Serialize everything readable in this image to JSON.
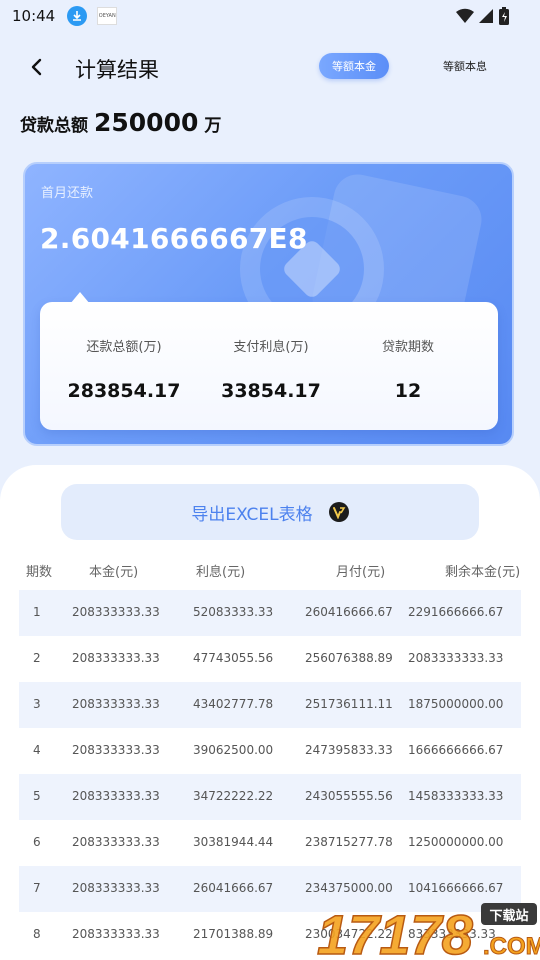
{
  "status_bar": {
    "time": "10:44",
    "app_icon_text": "OEYAN"
  },
  "header": {
    "title": "计算结果",
    "tab_active": "等额本金",
    "tab_inactive": "等额本息"
  },
  "loan": {
    "label": "贷款总额",
    "value": "250000",
    "unit": "万"
  },
  "card": {
    "first_month_label": "首月还款",
    "first_month_value": "2.6041666667E8",
    "summary": [
      {
        "label": "还款总额(万)",
        "value": "283854.17"
      },
      {
        "label": "支付利息(万)",
        "value": "33854.17"
      },
      {
        "label": "贷款期数",
        "value": "12"
      }
    ]
  },
  "export": {
    "label": "导出EXCEL表格"
  },
  "table": {
    "headers": [
      "期数",
      "本金(元)",
      "利息(元)",
      "月付(元)",
      "剩余本金(元)"
    ],
    "rows": [
      [
        "1",
        "208333333.33",
        "52083333.33",
        "260416666.67",
        "2291666666.67"
      ],
      [
        "2",
        "208333333.33",
        "47743055.56",
        "256076388.89",
        "2083333333.33"
      ],
      [
        "3",
        "208333333.33",
        "43402777.78",
        "251736111.11",
        "1875000000.00"
      ],
      [
        "4",
        "208333333.33",
        "39062500.00",
        "247395833.33",
        "1666666666.67"
      ],
      [
        "5",
        "208333333.33",
        "34722222.22",
        "243055555.56",
        "1458333333.33"
      ],
      [
        "6",
        "208333333.33",
        "30381944.44",
        "238715277.78",
        "1250000000.00"
      ],
      [
        "7",
        "208333333.33",
        "26041666.67",
        "234375000.00",
        "1041666666.67"
      ],
      [
        "8",
        "208333333.33",
        "21701388.89",
        "230034722.22",
        "833333333.33"
      ]
    ]
  },
  "watermark": {
    "digits": "17178",
    "tag": "下载站",
    "suffix": ".COM"
  },
  "colors": {
    "accent": "#5b8ef7",
    "card_bg": "#6c9cf8",
    "export_text": "#4d82ee",
    "row_shade": "#eef3fd"
  }
}
